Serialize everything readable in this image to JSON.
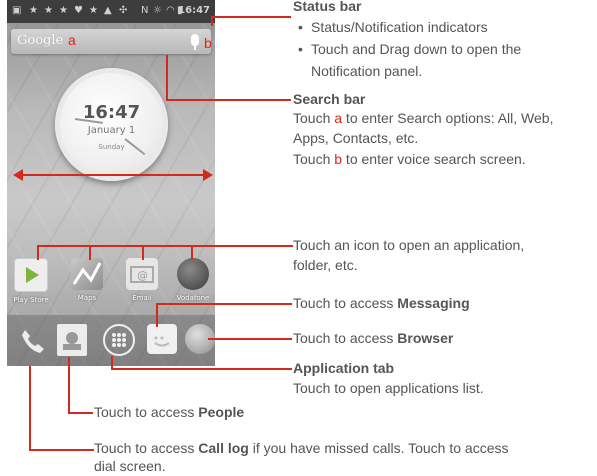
{
  "phone": {
    "status_time": "16:47",
    "search_logo": "Google",
    "search_label_a": "a",
    "search_label_b": "b",
    "clock_time": "16:47",
    "clock_date": "January 1",
    "clock_day": "Sunday",
    "apps": [
      "Play Store",
      "Maps",
      "Email",
      "Vodafone"
    ]
  },
  "callouts": {
    "status_bar": {
      "title": "Status bar",
      "bullets": [
        "Status/Notification indicators",
        "Touch and Drag down to open the",
        "Notification panel."
      ]
    },
    "search_bar": {
      "title": "Search bar",
      "line1_pre": "Touch ",
      "line1_key": "a",
      "line1_post": " to enter Search options: All, Web,",
      "line2": "Apps, Contacts, etc.",
      "line3_pre": "Touch ",
      "line3_key": "b",
      "line3_post": " to enter voice search screen."
    },
    "icon": {
      "line1": "Touch an icon to open an application,",
      "line2": "folder, etc."
    },
    "messaging": {
      "pre": "Touch to access ",
      "bold": "Messaging"
    },
    "browser": {
      "pre": "Touch to access ",
      "bold": "Browser"
    },
    "app_tab": {
      "title": "Application tab",
      "text": "Touch to open applications list."
    },
    "people": {
      "pre": "Touch to access ",
      "bold": "People"
    },
    "call_log": {
      "pre": "Touch to access ",
      "bold": "Call log",
      "post": " if you have missed calls. Touch to access",
      "line2": "dial screen."
    }
  },
  "colors": {
    "accent_red": "#e2231a",
    "text_gray": "#555555"
  }
}
